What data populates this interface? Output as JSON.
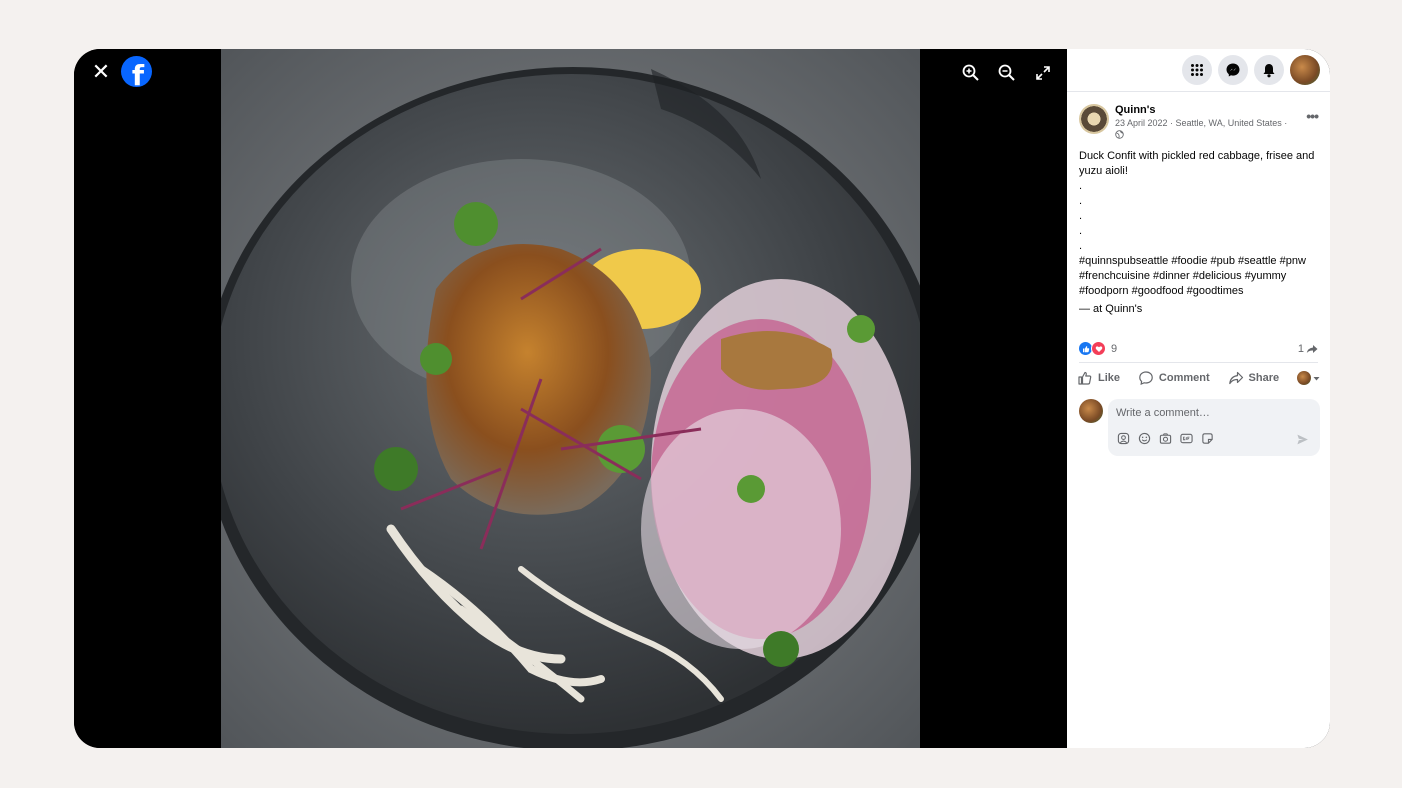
{
  "viewer": {
    "close_label": "✕",
    "logo_letter": "f",
    "tools": [
      "zoom-in-icon",
      "zoom-out-icon",
      "expand-icon"
    ]
  },
  "topbar": {
    "icons": [
      "menu-grid-icon",
      "messenger-icon",
      "notifications-icon",
      "profile-avatar"
    ]
  },
  "post": {
    "page_name": "Quinn's",
    "date_location": "23 April 2022 · Seattle, WA, United States ·",
    "caption_main": "Duck Confit with pickled red cabbage, frisee and yuzu aioli!",
    "caption_dots": [
      ".",
      ".",
      ".",
      ".",
      "."
    ],
    "hashtags": "#quinnspubseattle #foodie #pub #seattle #pnw #frenchcuisine #dinner #delicious #yummy #foodporn #goodfood #goodtimes",
    "at_prefix": "— at ",
    "at_place": "Quinn's"
  },
  "engagement": {
    "reaction_count": "9",
    "share_count": "1"
  },
  "actions": {
    "like": "Like",
    "comment": "Comment",
    "share": "Share"
  },
  "comment": {
    "placeholder": "Write a comment…"
  },
  "colors": {
    "brand": "#0866ff",
    "like": "#1877f2",
    "love": "#f33e58",
    "muted": "#65676b"
  }
}
